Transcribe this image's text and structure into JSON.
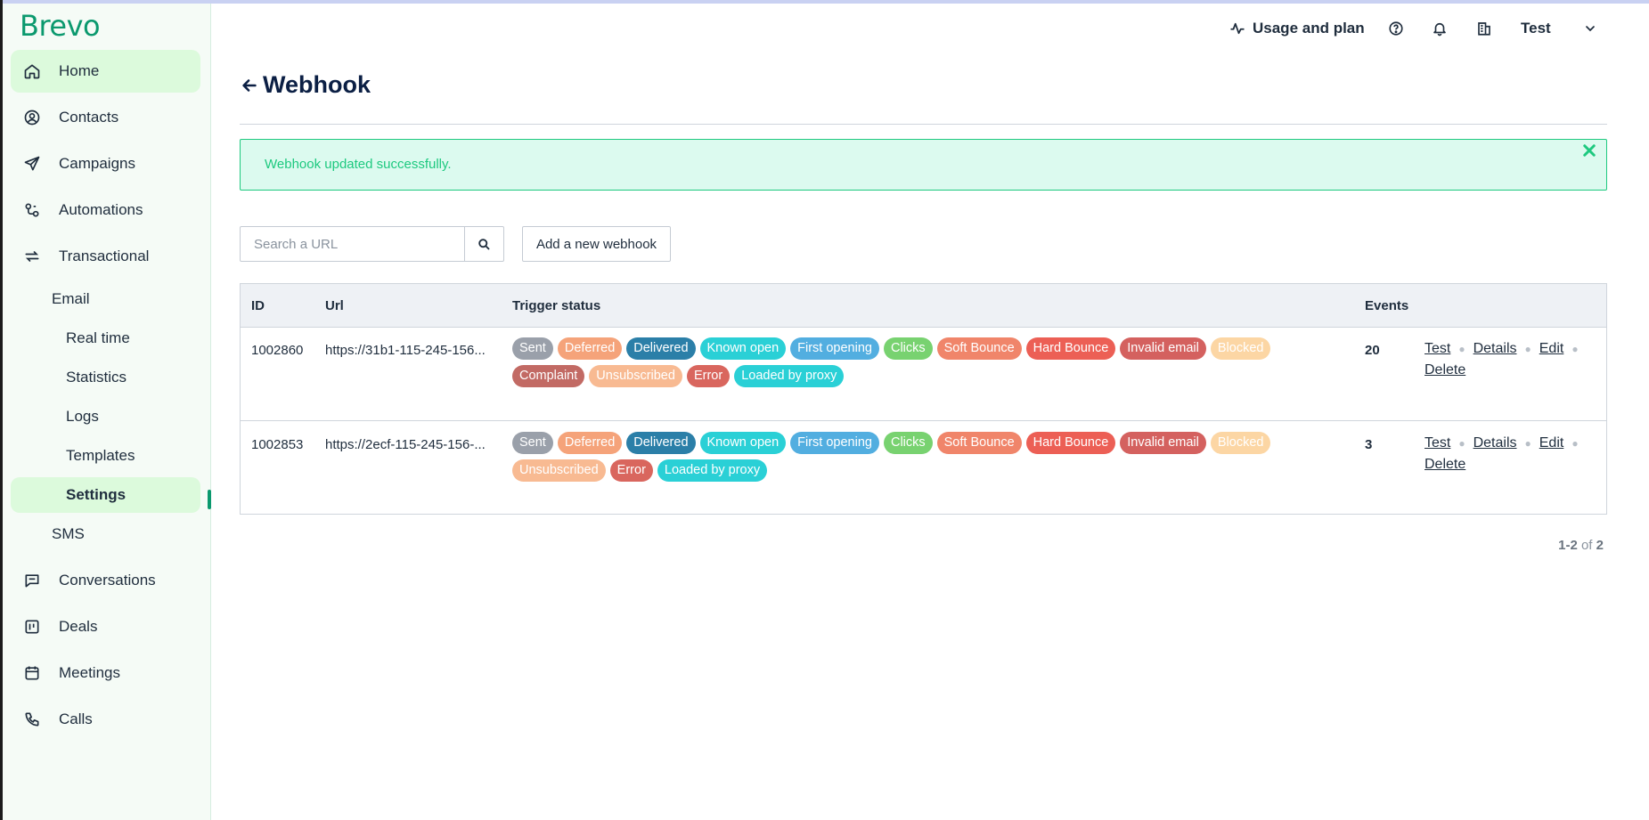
{
  "brand": {
    "name": "Brevo",
    "color": "#0b996e"
  },
  "sidebar": {
    "items": [
      {
        "label": "Home",
        "icon": "home-icon"
      },
      {
        "label": "Contacts",
        "icon": "contacts-icon"
      },
      {
        "label": "Campaigns",
        "icon": "send-icon"
      },
      {
        "label": "Automations",
        "icon": "automation-icon"
      },
      {
        "label": "Transactional",
        "icon": "repeat-icon"
      },
      {
        "label": "Conversations",
        "icon": "chat-icon"
      },
      {
        "label": "Deals",
        "icon": "deals-icon"
      },
      {
        "label": "Meetings",
        "icon": "calendar-icon"
      },
      {
        "label": "Calls",
        "icon": "phone-icon"
      }
    ],
    "sub": {
      "email": "Email",
      "real_time": "Real time",
      "statistics": "Statistics",
      "logs": "Logs",
      "templates": "Templates",
      "settings": "Settings",
      "sms": "SMS"
    }
  },
  "topbar": {
    "usage_label": "Usage and plan",
    "account_name": "Test"
  },
  "page": {
    "title": "Webhook"
  },
  "alert": {
    "message": "Webhook updated successfully."
  },
  "toolbar": {
    "search_placeholder": "Search a URL",
    "add_button": "Add a new webhook"
  },
  "table": {
    "headers": {
      "id": "ID",
      "url": "Url",
      "trigger": "Trigger status",
      "events": "Events"
    },
    "rows": [
      {
        "id": "1002860",
        "url": "https://31b1-115-245-156...",
        "tags": [
          "Sent",
          "Deferred",
          "Delivered",
          "Known open",
          "First opening",
          "Clicks",
          "Soft Bounce",
          "Hard Bounce",
          "Invalid email",
          "Blocked",
          "Complaint",
          "Unsubscribed",
          "Error",
          "Loaded by proxy"
        ],
        "events": "20"
      },
      {
        "id": "1002853",
        "url": "https://2ecf-115-245-156-...",
        "tags": [
          "Sent",
          "Deferred",
          "Delivered",
          "Known open",
          "First opening",
          "Clicks",
          "Soft Bounce",
          "Hard Bounce",
          "Invalid email",
          "Blocked",
          "Unsubscribed",
          "Error",
          "Loaded by proxy"
        ],
        "events": "3"
      }
    ],
    "actions": {
      "test": "Test",
      "details": "Details",
      "edit": "Edit",
      "delete": "Delete"
    }
  },
  "tag_colors": {
    "Sent": "#9aa0aa",
    "Deferred": "#f5a37a",
    "Delivered": "#2b7fa8",
    "Known open": "#2ad0d6",
    "First opening": "#52aee0",
    "Clicks": "#78d270",
    "Soft Bounce": "#f0856a",
    "Hard Bounce": "#ec5f55",
    "Invalid email": "#d4615f",
    "Blocked": "#fcd6a4",
    "Complaint": "#c26a64",
    "Unsubscribed": "#f8ba92",
    "Error": "#d9665e",
    "Loaded by proxy": "#2ad0d6"
  },
  "pagination": {
    "range": "1-2",
    "of": "of",
    "total": "2"
  }
}
